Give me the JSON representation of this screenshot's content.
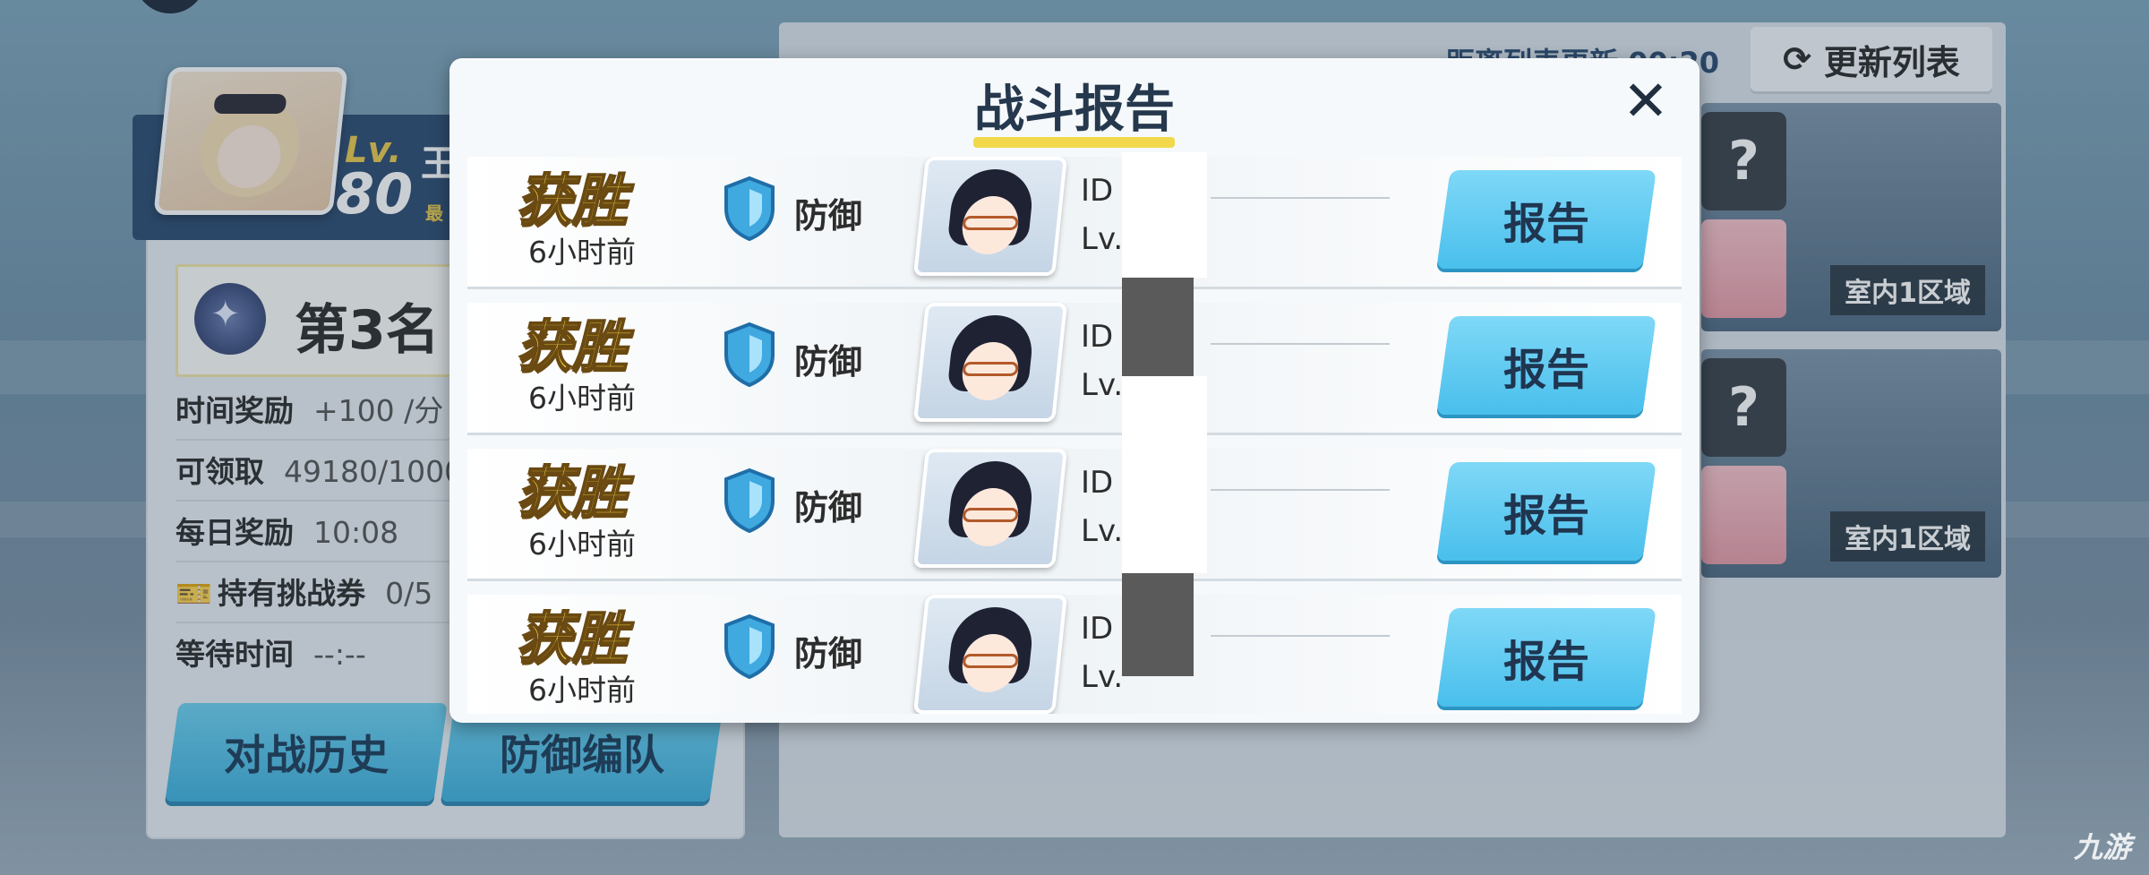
{
  "player": {
    "lv_label": "Lv.",
    "level": "80",
    "name_stub": "王",
    "name_sub_stub": "最",
    "rank": "第3名"
  },
  "stats": [
    {
      "label": "时间奖励",
      "value": "+100 /分"
    },
    {
      "label": "可领取",
      "value": "49180/1000"
    },
    {
      "label": "每日奖励",
      "value": "10:08"
    },
    {
      "label": "持有挑战券",
      "value": "0/5"
    },
    {
      "label": "等待时间",
      "value": "--:--"
    }
  ],
  "left_buttons": {
    "history": "对战历史",
    "defense_team": "防御编队"
  },
  "right_panel": {
    "refresh_timer": "距离列表更新 00:20",
    "refresh_button": "更新列表",
    "cards": [
      {
        "badge": "?",
        "area": "室内1区域"
      },
      {
        "badge": "?",
        "area": "室内1区域"
      }
    ]
  },
  "modal": {
    "title": "战斗报告",
    "close_icon": "close-icon",
    "rows": [
      {
        "result": "获胜",
        "time": "6小时前",
        "mode": "防御",
        "id_label": "ID",
        "lv_label": "Lv.",
        "button": "报告"
      },
      {
        "result": "获胜",
        "time": "6小时前",
        "mode": "防御",
        "id_label": "ID",
        "lv_label": "Lv.",
        "button": "报告"
      },
      {
        "result": "获胜",
        "time": "6小时前",
        "mode": "防御",
        "id_label": "ID",
        "lv_label": "Lv.",
        "button": "报告"
      },
      {
        "result": "获胜",
        "time": "6小时前",
        "mode": "防御",
        "id_label": "ID",
        "lv_label": "Lv.",
        "button": "报告"
      }
    ]
  },
  "watermark": "九游",
  "colors": {
    "accent_blue": "#49bfec",
    "victory_yellow": "#f4d23c",
    "title_navy": "#25384d"
  }
}
